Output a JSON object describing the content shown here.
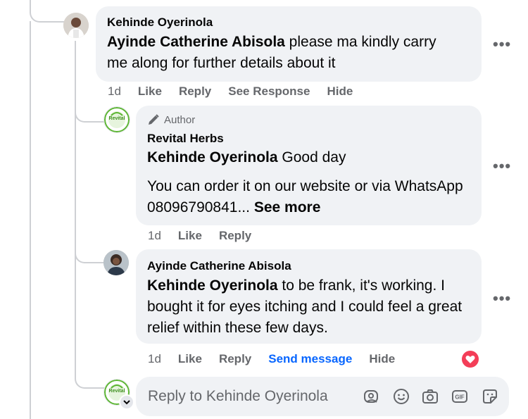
{
  "comment1": {
    "author": "Kehinde Oyerinola",
    "mention": "Ayinde Catherine Abisola",
    "text": " please ma kindly carry me along for further details about it",
    "time": "1d",
    "actions": {
      "like": "Like",
      "reply": "Reply",
      "see_response": "See Response",
      "hide": "Hide"
    }
  },
  "comment2": {
    "badge": "Author",
    "author": "Revital Herbs",
    "avatar_text": "Revital",
    "mention": "Kehinde Oyerinola",
    "text1": " Good day",
    "text2": "You can order it on our website or via WhatsApp 08096790841...",
    "see_more": " See more",
    "time": "1d",
    "actions": {
      "like": "Like",
      "reply": "Reply"
    }
  },
  "comment3": {
    "author": "Ayinde Catherine Abisola",
    "mention": "Kehinde Oyerinola",
    "text": " to be frank, it's working. I bought it for eyes itching and I could feel a great relief within these few days.",
    "time": "1d",
    "actions": {
      "like": "Like",
      "reply": "Reply",
      "send_message": "Send message",
      "hide": "Hide"
    },
    "reaction": "love"
  },
  "reply_box": {
    "placeholder": "Reply to Kehinde Oyerinola",
    "avatar_text": "Revital",
    "icons": [
      "avatar-sticker-icon",
      "emoji-icon",
      "camera-icon",
      "gif-icon",
      "sticker-icon"
    ]
  },
  "more_label": "•••",
  "colors": {
    "bubble": "#f0f2f5",
    "secondary_text": "#65676b",
    "link_blue": "#0866ff",
    "love": "#f33e58",
    "brand_green": "#5bb531"
  }
}
